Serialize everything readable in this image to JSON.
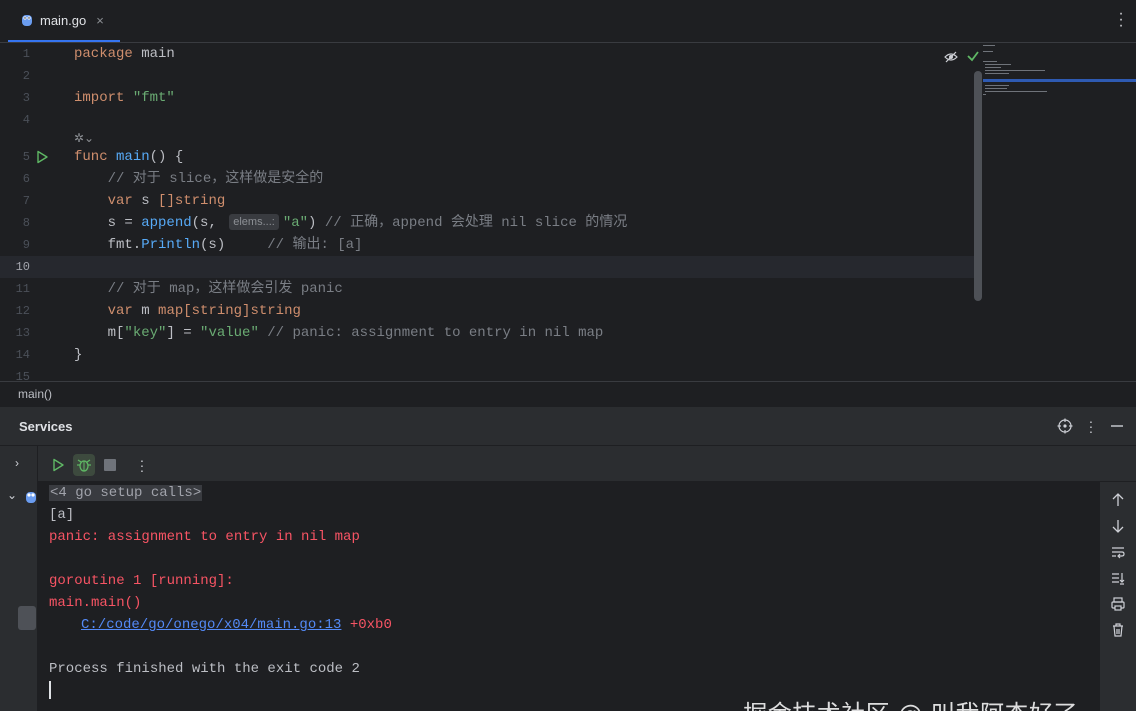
{
  "tab": {
    "label": "main.go",
    "close": "×",
    "icon": "gopher-icon"
  },
  "editor": {
    "line_numbers": [
      "1",
      "2",
      "3",
      "4",
      "5",
      "6",
      "7",
      "8",
      "9",
      "10",
      "11",
      "12",
      "13",
      "14",
      "15"
    ],
    "line1": {
      "kw": "package",
      "id": " main"
    },
    "line3": {
      "kw": "import",
      "str": " \"fmt\""
    },
    "line5": {
      "kw": "func",
      "fn": " main",
      "rest": "() {"
    },
    "line6": {
      "cm": "    // 对于 slice，这样做是安全的"
    },
    "line7": {
      "indent": "    ",
      "kw": "var",
      "id": " s ",
      "ty": "[]string"
    },
    "line8": {
      "pre": "    s = ",
      "fn": "append",
      "mid": "(s, ",
      "hint": "elems...:",
      "str": "\"a\"",
      "end": ") ",
      "cm": "// 正确，append 会处理 nil slice 的情况"
    },
    "line9": {
      "pre": "    fmt.",
      "fn": "Println",
      "mid": "(s)     ",
      "cm": "// 输出: [a]"
    },
    "line11": {
      "cm": "    // 对于 map，这样做会引发 panic"
    },
    "line12": {
      "indent": "    ",
      "kw": "var",
      "id": " m ",
      "ty": "map[string]string"
    },
    "line13": {
      "pre": "    m[",
      "str1": "\"key\"",
      "mid": "] = ",
      "str2": "\"value\"",
      "sp": " ",
      "cm": "// panic: assignment to entry in nil map"
    },
    "line14": {
      "id": "}"
    }
  },
  "breadcrumb": "main()",
  "services": {
    "title": "Services",
    "console": {
      "setup": "<4 go setup calls>",
      "out1": "[a]",
      "panic": "panic: assignment to entry in nil map",
      "goroutine": "goroutine 1 [running]:",
      "frame": "main.main()",
      "link": "C:/code/go/onego/x04/main.go:13",
      "offset": " +0xb0",
      "exit": "Process finished with the exit code 2"
    }
  },
  "watermark": "掘金技术社区 @ 叫我阿杰好了",
  "colors": {
    "accent": "#3574f0",
    "error": "#f75464",
    "run": "#5fb865"
  }
}
